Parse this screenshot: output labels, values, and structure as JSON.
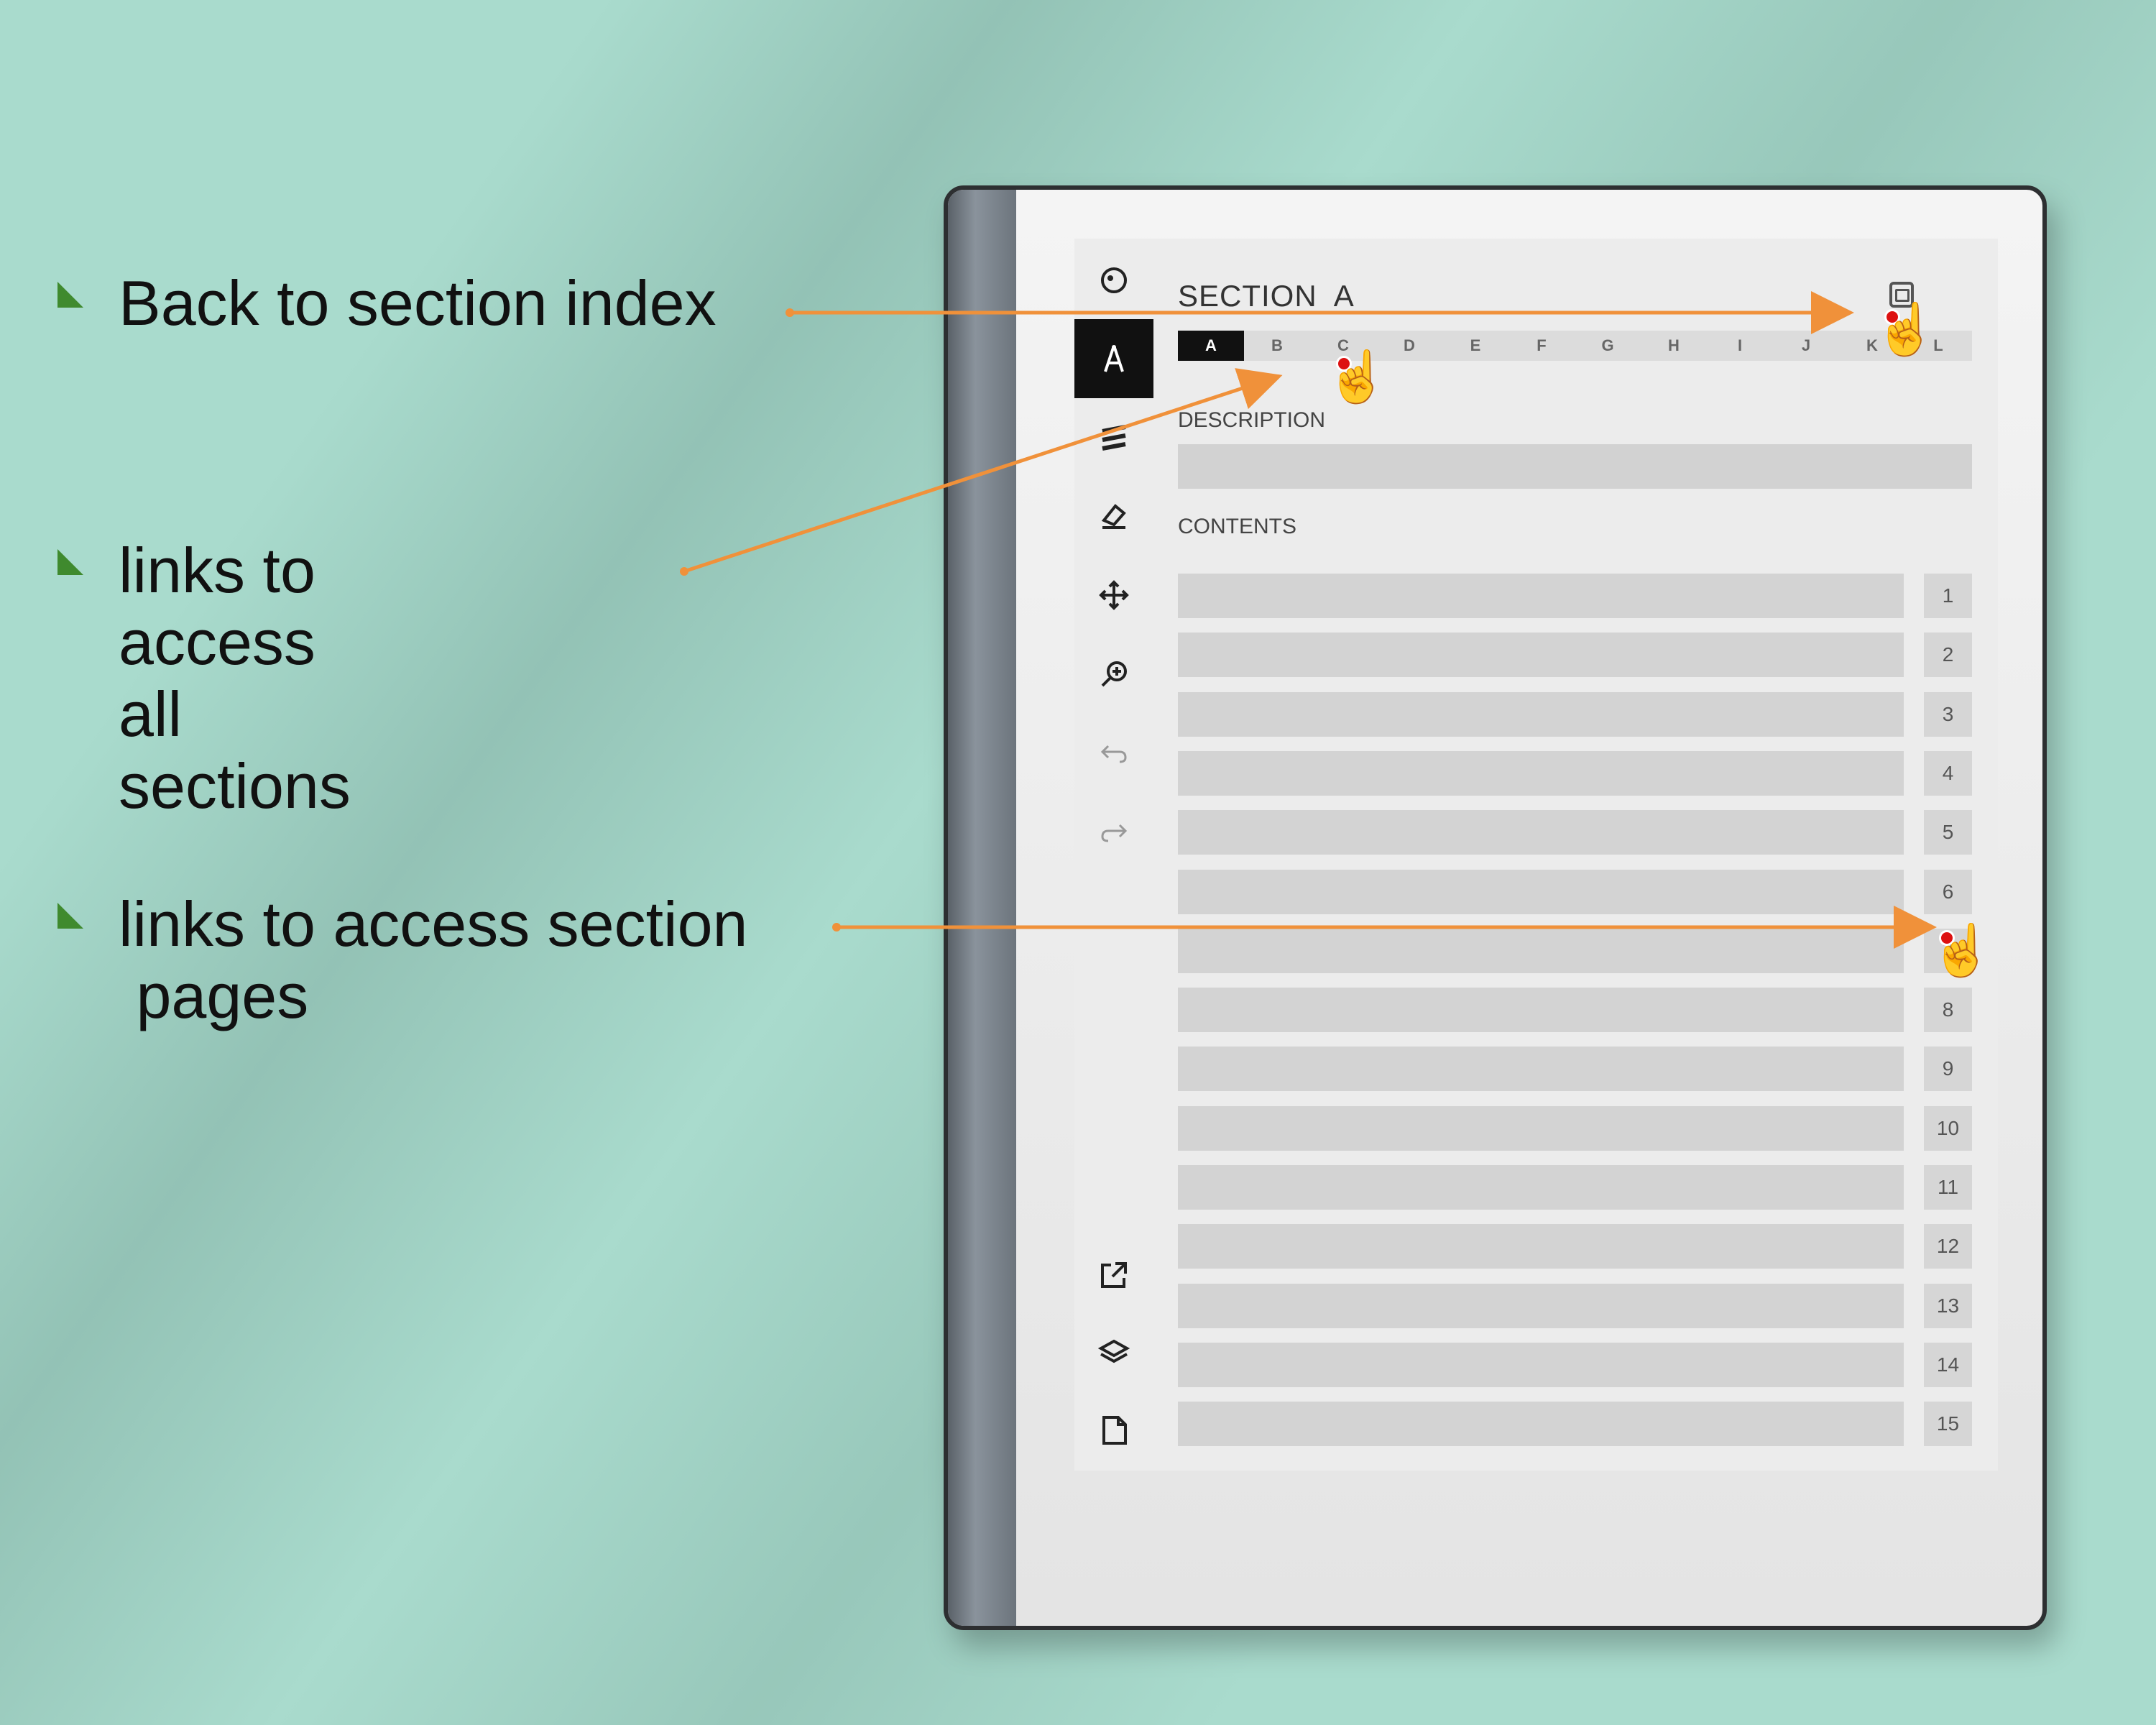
{
  "callouts": [
    {
      "text": "Back to section index"
    },
    {
      "text": "links to access all\nsections"
    },
    {
      "text": "links to access section\n pages"
    }
  ],
  "page": {
    "title": "SECTION  A",
    "tabs": [
      "A",
      "B",
      "C",
      "D",
      "E",
      "F",
      "G",
      "H",
      "I",
      "J",
      "K",
      "L"
    ],
    "active_tab": "A",
    "description_label": "DESCRIPTION",
    "contents_label": "CONTENTS",
    "rows": [
      "1",
      "2",
      "3",
      "4",
      "5",
      "6",
      "7",
      "8",
      "9",
      "10",
      "11",
      "12",
      "13",
      "14",
      "15"
    ]
  },
  "toolbar": {
    "icons": [
      "menu-circle-icon",
      "pen-icon",
      "highlighter-icon",
      "eraser-icon",
      "move-icon",
      "zoom-icon",
      "undo-icon",
      "redo-icon",
      "share-icon",
      "layers-icon",
      "page-icon"
    ]
  },
  "colors": {
    "background": "#a9dbcd",
    "arrow": "#f0913a",
    "bullet": "#3f8a2e",
    "active_tab": "#111111"
  }
}
